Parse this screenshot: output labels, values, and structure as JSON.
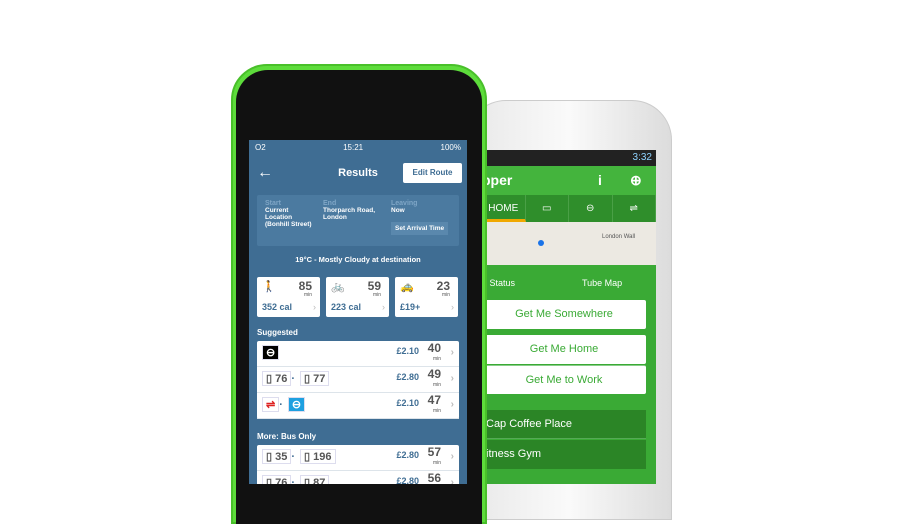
{
  "android": {
    "status_time": "3:32",
    "app_title": "pper",
    "info_icon": "info-icon",
    "locate_icon": "crosshair-icon",
    "tabs": [
      {
        "label": "HOME"
      },
      {
        "label": "bus-icon"
      },
      {
        "label": "underground-icon"
      },
      {
        "label": "rail-icon"
      }
    ],
    "map_label": "London Wall",
    "status_label": "e Status",
    "tube_map_label": "Tube Map",
    "buttons": [
      "Get Me Somewhere",
      "Get Me Home",
      "Get Me to Work"
    ],
    "places": [
      "Cap Coffee Place",
      "itness Gym"
    ],
    "accent": "#3aaa35"
  },
  "iphone": {
    "carrier": "O2",
    "time": "15:21",
    "battery": "100%",
    "title": "Results",
    "edit_button": "Edit Route",
    "start_label": "Start",
    "start_value": "Current Location (Bonhill Street)",
    "end_label": "End",
    "end_value": "Thorparch Road, London",
    "leaving_label": "Leaving",
    "leaving_value": "Now",
    "arrival_button": "Set Arrival Time",
    "weather": "19°C - Mostly Cloudy at destination",
    "modes": [
      {
        "icon": "walk-icon",
        "mins": "85",
        "sub": "352 cal"
      },
      {
        "icon": "bicycle-icon",
        "mins": "59",
        "sub": "223 cal"
      },
      {
        "icon": "taxi-icon",
        "mins": "23",
        "sub": "£19+"
      }
    ],
    "min_label": "min",
    "suggested_label": "Suggested",
    "suggested": [
      {
        "route": [],
        "price": "£2.10",
        "mins": "40"
      },
      {
        "route": [
          "76",
          "77"
        ],
        "price": "£2.80",
        "mins": "49"
      },
      {
        "route": [],
        "price": "£2.10",
        "mins": "47"
      }
    ],
    "bus_label": "More: Bus Only",
    "bus": [
      {
        "route": [
          "35",
          "196"
        ],
        "price": "£2.80",
        "mins": "57"
      },
      {
        "route": [
          "76",
          "87"
        ],
        "price": "£2.80",
        "mins": "56"
      }
    ]
  }
}
